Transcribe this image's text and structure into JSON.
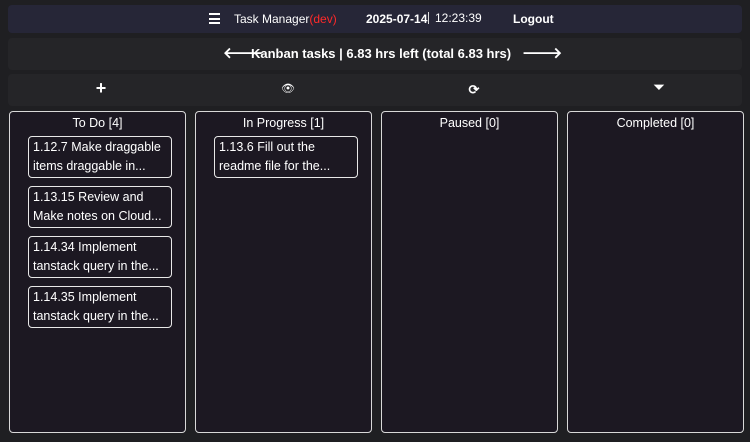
{
  "header": {
    "title": "Task Manager",
    "env": "(dev)",
    "date": "2025-07-14",
    "time": "12:23:39",
    "logout": "Logout"
  },
  "nav": {
    "summary": "Kanban tasks | 6.83 hrs left (total 6.83 hrs)",
    "prev": "🡐",
    "next": "🡒"
  },
  "toolbar": {
    "add": "+",
    "view": "👁",
    "refresh": "⟳",
    "filter": "⏷"
  },
  "columns": [
    {
      "title": "To Do [4]",
      "cards": [
        {
          "line1": "1.12.7 Make draggable",
          "line2": "items draggable in..."
        },
        {
          "line1": "1.13.15 Review and",
          "line2": "Make notes on Cloud..."
        },
        {
          "line1": "1.14.34 Implement",
          "line2": "tanstack query in the..."
        },
        {
          "line1": "1.14.35 Implement",
          "line2": "tanstack query in the..."
        }
      ]
    },
    {
      "title": "In Progress [1]",
      "cards": [
        {
          "line1": "1.13.6 Fill out the",
          "line2": "readme file for the..."
        }
      ]
    },
    {
      "title": "Paused [0]",
      "cards": []
    },
    {
      "title": "Completed [0]",
      "cards": []
    }
  ]
}
